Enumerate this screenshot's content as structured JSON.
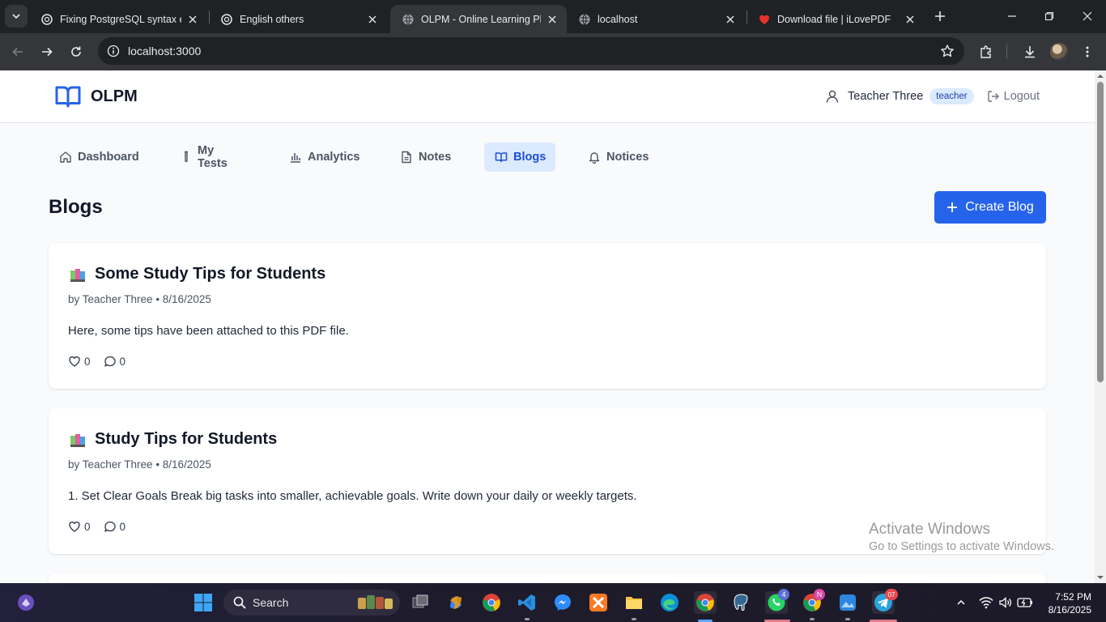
{
  "browser": {
    "tabs": [
      {
        "title": "Fixing PostgreSQL syntax err",
        "icon": "chatgpt-icon"
      },
      {
        "title": "English others",
        "icon": "chatgpt-icon"
      },
      {
        "title": "OLPM - Online Learning Platf",
        "icon": "globe-icon",
        "active": true
      },
      {
        "title": "localhost",
        "icon": "globe-icon"
      },
      {
        "title": "Download file | iLovePDF",
        "icon": "heart-icon"
      }
    ],
    "url": "localhost:3000"
  },
  "header": {
    "brand": "OLPM",
    "user_name": "Teacher Three",
    "role": "teacher",
    "logout_label": "Logout"
  },
  "nav": {
    "tabs": [
      {
        "label": "Dashboard",
        "icon": "home-icon"
      },
      {
        "label": "My Tests",
        "icon": "test-tube-icon"
      },
      {
        "label": "Analytics",
        "icon": "bar-chart-icon"
      },
      {
        "label": "Notes",
        "icon": "document-icon"
      },
      {
        "label": "Blogs",
        "icon": "book-open-icon",
        "active": true
      },
      {
        "label": "Notices",
        "icon": "bell-icon"
      }
    ]
  },
  "main": {
    "title": "Blogs",
    "create_label": "Create Blog",
    "posts": [
      {
        "title": "Some Study Tips for Students",
        "meta": "by Teacher Three • 8/16/2025",
        "excerpt": "Here, some tips have been attached to this PDF file.",
        "likes": "0",
        "comments": "0"
      },
      {
        "title": "Study Tips for Students",
        "meta": "by Teacher Three • 8/16/2025",
        "excerpt": "1. Set Clear Goals Break big tasks into smaller, achievable goals. Write down your daily or weekly targets.",
        "likes": "0",
        "comments": "0"
      }
    ]
  },
  "watermark": {
    "line1": "Activate Windows",
    "line2": "Go to Settings to activate Windows."
  },
  "taskbar": {
    "search_label": "Search",
    "time": "7:52 PM",
    "date": "8/16/2025",
    "whatsapp_badge": "4",
    "telegram_badge": "07",
    "chrome_profile_badge": "N"
  },
  "colors": {
    "accent": "#2563eb",
    "active_tab_bg": "#dbeafe",
    "page_bg": "#f8fafc"
  }
}
